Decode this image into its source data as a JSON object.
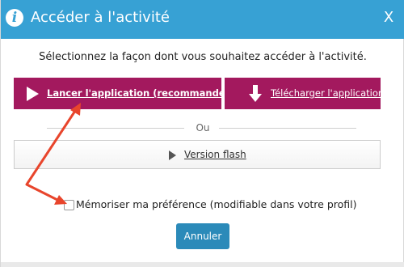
{
  "dialog": {
    "title": "Accéder à l'activité",
    "close_label": "X",
    "prompt": "Sélectionnez la façon dont vous souhaitez accéder à l'activité.",
    "launch_label": "Lancer l'application (recommandé)",
    "download_label": "Télécharger l'application",
    "separator_label": "Ou",
    "flash_label": "Version flash",
    "remember_label": "Mémoriser ma préférence (modifiable dans votre profil)",
    "remember_checked": false,
    "cancel_label": "Annuler"
  },
  "icons": {
    "title": "info-icon",
    "launch": "play-icon",
    "download": "download-arrow-icon",
    "flash": "play-icon"
  },
  "colors": {
    "title_bar": "#37a1d4",
    "primary_button": "#a3195e",
    "cancel_button": "#2b8ab9",
    "annotation_arrow": "#e8452c"
  }
}
